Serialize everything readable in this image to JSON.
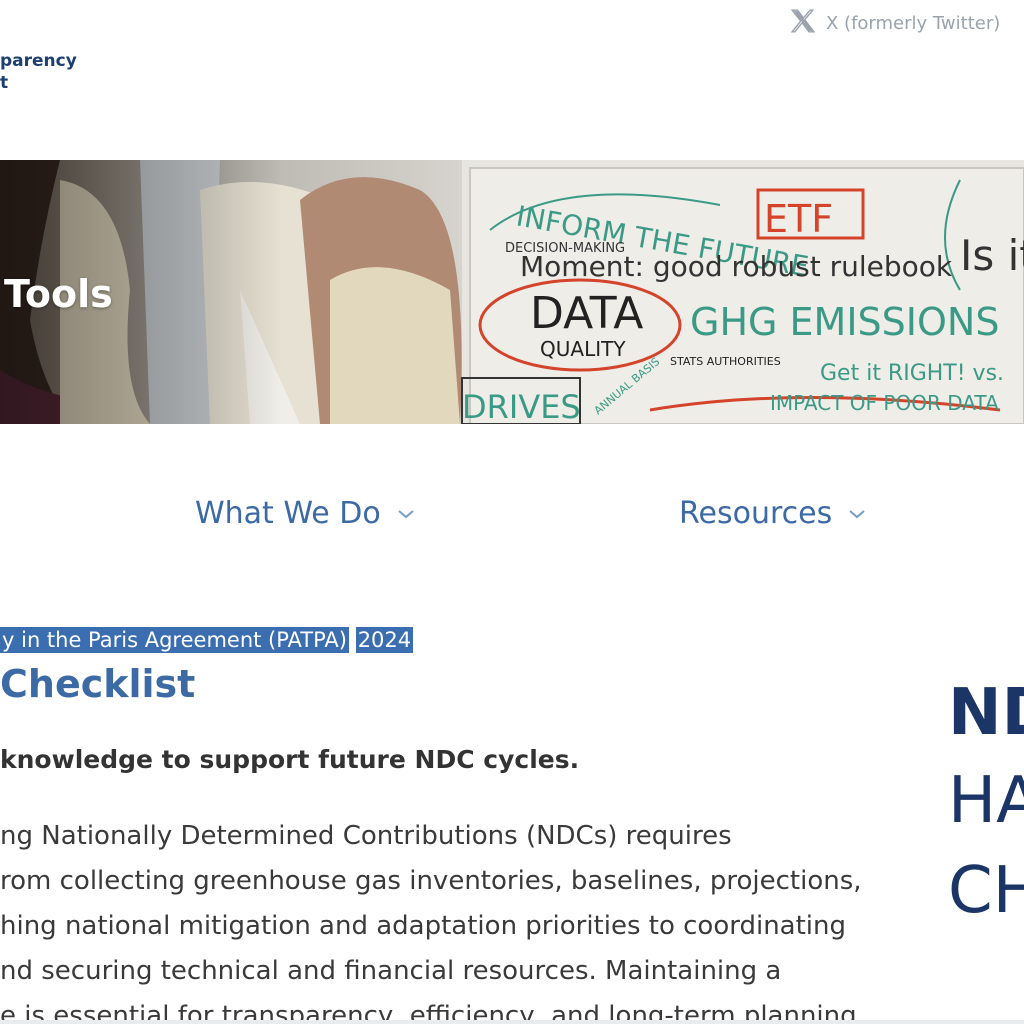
{
  "header": {
    "logo_line1": "parency",
    "logo_line2": "t",
    "social_link": "X (formerly Twitter)"
  },
  "hero": {
    "title": "Tools",
    "whiteboard_text": [
      "INFORM THE FUTURE",
      "DECISION-MAKING",
      "Moment: good robust rulebook",
      "ETF",
      "Is it",
      "DATA",
      "QUALITY",
      "GHG EMISSIONS",
      "STATS AUTHORITIES",
      "Get it RIGHT! vs.",
      "IMPACT OF POOR DATA",
      "DRIVES",
      "ANNUAL BASIS"
    ]
  },
  "nav": {
    "items": [
      {
        "label": "What We Do"
      },
      {
        "label": "Resources"
      }
    ]
  },
  "article": {
    "breadcrumb_main": "y in the Paris Agreement (PATPA)",
    "breadcrumb_year": "2024",
    "title": "Checklist",
    "lead": "knowledge to support future NDC cycles.",
    "body_lines": [
      "ng Nationally Determined Contributions (NDCs) requires",
      "rom collecting greenhouse gas inventories, baselines, projections,",
      "hing national mitigation and adaptation priorities to coordinating",
      "nd securing technical and financial resources. Maintaining a",
      "e is essential for transparency, efficiency, and long-term planning."
    ]
  },
  "cover": {
    "line1": "ND",
    "line2": "HA",
    "line3": "CH"
  },
  "colors": {
    "brand_dark": "#1b3f73",
    "link_blue": "#3c6aa5",
    "highlight": "#3a6eb1"
  }
}
